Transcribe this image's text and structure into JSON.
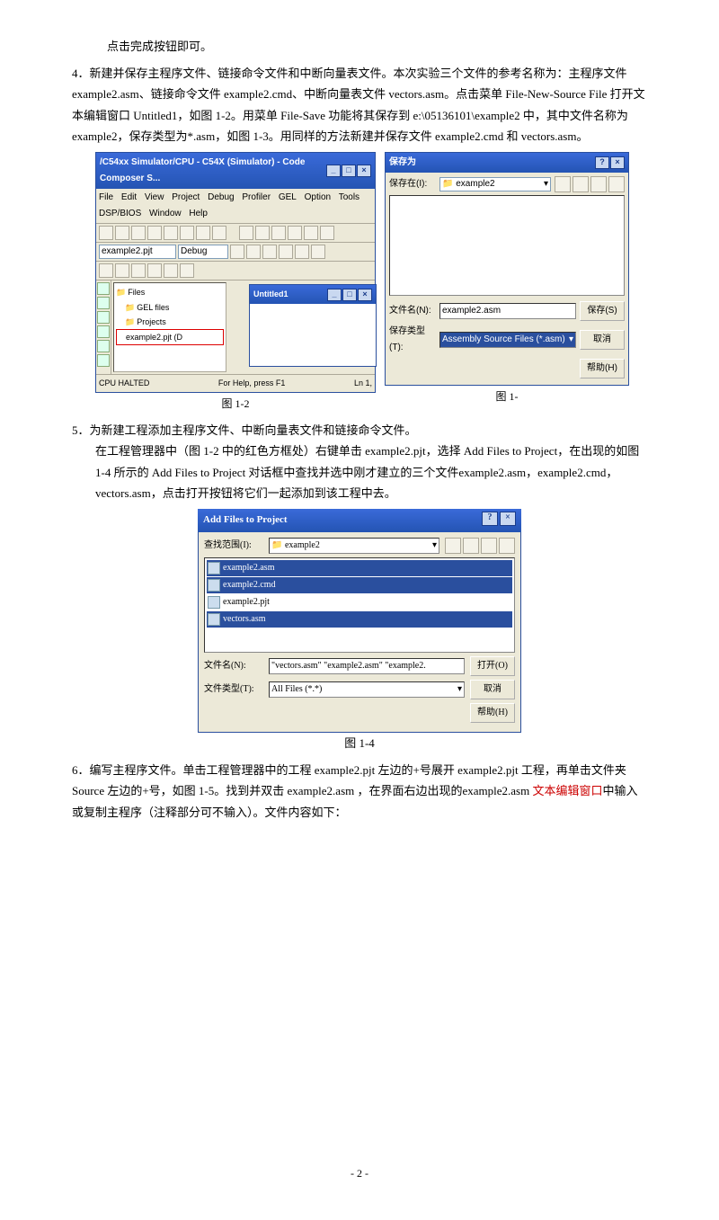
{
  "intro_line": "点击完成按钮即可。",
  "step4": {
    "num": "4．",
    "title": "新建并保存主程序文件、链接命令文件和中断向量表文件。本次实验三个文件的参考名称为：主程序文件 example2.asm、链接命令文件 example2.cmd、中断向量表文件 vectors.asm。点击菜单 File-New-Source File 打开文本编辑窗口 Untitled1，如图 1-2。用菜单 File-Save 功能将其保存到 e:\\05136101\\example2 中，其中文件名称为 example2，保存类型为*.asm，如图 1-3。用同样的方法新建并保存文件 example2.cmd 和 vectors.asm。"
  },
  "fig12": {
    "title": "/C54xx Simulator/CPU - C54X (Simulator) - Code Composer S...",
    "menus": [
      "File",
      "Edit",
      "View",
      "Project",
      "Debug",
      "Profiler",
      "GEL",
      "Option",
      "Tools",
      "DSP/BIOS",
      "Window",
      "Help"
    ],
    "project_combo": "example2.pjt",
    "config_combo": "Debug",
    "tree": {
      "root": "Files",
      "items": [
        "GEL files",
        "Projects",
        "example2.pjt (D"
      ]
    },
    "untitled": "Untitled1",
    "status_left": "CPU HALTED",
    "status_right": "For Help, press F1",
    "status_ln": "Ln 1,",
    "caption": "图 1-2"
  },
  "fig13": {
    "title": "保存为",
    "save_in_label": "保存在(I):",
    "save_in_value": "example2",
    "filename_label": "文件名(N):",
    "filename_value": "example2.asm",
    "type_label": "保存类型(T):",
    "type_value": "Assembly Source Files (*.asm)",
    "btn_save": "保存(S)",
    "btn_cancel": "取消",
    "btn_help": "帮助(H)",
    "caption": "图 1-"
  },
  "step5": {
    "num": "5．",
    "line1": "为新建工程添加主程序文件、中断向量表文件和链接命令文件。",
    "line2": "在工程管理器中（图 1-2 中的红色方框处）右键单击 example2.pjt，选择 Add Files to Project，在出现的如图 1-4 所示的 Add Files to Project 对话框中查找并选中刚才建立的三个文件example2.asm，example2.cmd，vectors.asm，点击打开按钮将它们一起添加到该工程中去。"
  },
  "fig14": {
    "title": "Add Files to Project",
    "lookin_label": "查找范围(I):",
    "lookin_value": "example2",
    "files": [
      {
        "name": "example2.asm",
        "sel": true
      },
      {
        "name": "example2.cmd",
        "sel": true
      },
      {
        "name": "example2.pjt",
        "sel": false
      },
      {
        "name": "vectors.asm",
        "sel": true
      }
    ],
    "filename_label": "文件名(N):",
    "filename_value": "\"vectors.asm\" \"example2.asm\" \"example2.",
    "type_label": "文件类型(T):",
    "type_value": "All Files (*.*)",
    "btn_open": "打开(O)",
    "btn_cancel": "取消",
    "btn_help": "帮助(H)",
    "caption": "图 1-4"
  },
  "step6": {
    "num": "6．",
    "part1": "编写主程序文件。单击工程管理器中的工程 example2.pjt 左边的+号展开 example2.pjt 工程，再单击文件夹 Source 左边的+号，如图 1-5。找到并双击 example2.asm ，在界面右边出现的example2.asm ",
    "red": "文本编辑窗口",
    "part2": "中输入或复制主程序（注释部分可不输入）。文件内容如下："
  },
  "page_number": "- 2 -"
}
